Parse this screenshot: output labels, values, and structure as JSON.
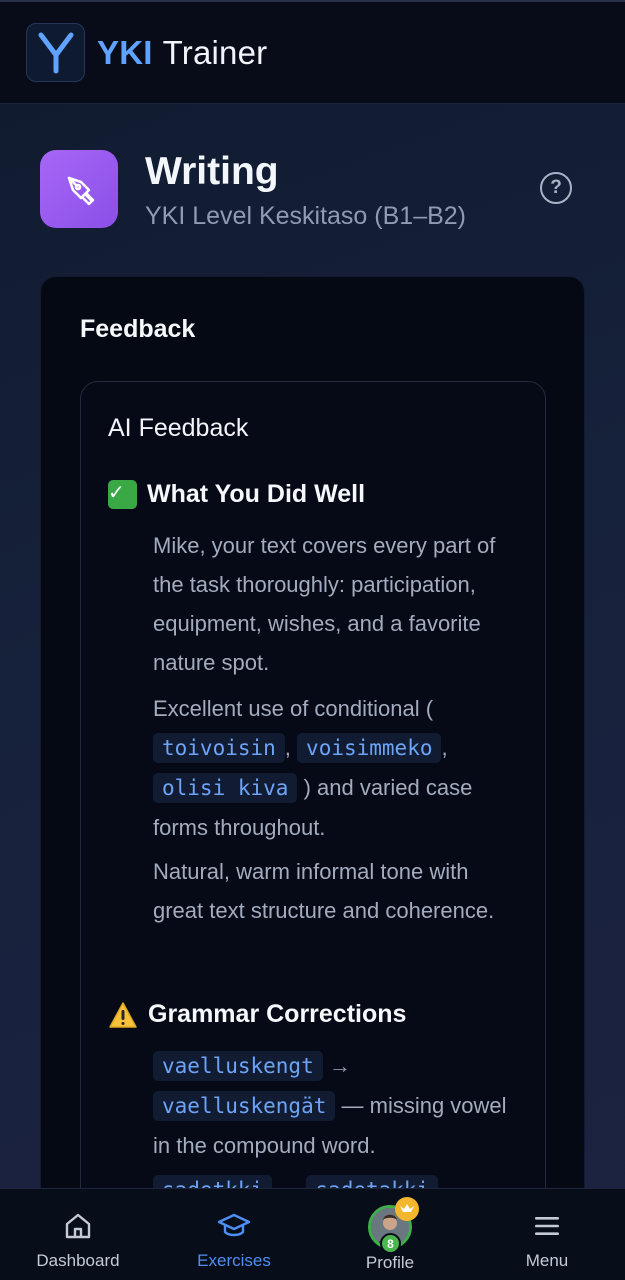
{
  "app": {
    "brand_part1": "YKI",
    "brand_part2": "Trainer",
    "logo_letter": "Y"
  },
  "header": {
    "title": "Writing",
    "subtitle": "YKI Level Keskitaso (B1–B2)",
    "help_icon": "question-circle-icon",
    "section_icon": "pen-icon",
    "accent": "#a066f5"
  },
  "feedback": {
    "card_title": "Feedback",
    "panel_title": "AI Feedback",
    "well": {
      "heading": "What You Did Well",
      "p1": "Mike, your text covers every part of the task thoroughly: participation, equipment, wishes, and a favorite nature spot.",
      "p2_pre": "Excellent use of conditional (",
      "p2_code1": "toivoisin",
      "p2_sep1": ",",
      "p2_code2": "voisimmeko",
      "p2_sep2": ",",
      "p2_code3": "olisi kiva",
      "p2_post": ") and varied case forms throughout.",
      "p3": "Natural, warm informal tone with great text structure and coherence."
    },
    "grammar": {
      "heading": "Grammar Corrections",
      "c1_wrong": "vaelluskengt",
      "arrow": "→",
      "c1_right": "vaelluskengät",
      "c1_note": "— missing vowel in the compound word.",
      "c2_wrong": "sadetkki",
      "c2_right": "sadetakki",
      "c2_note": "—"
    }
  },
  "nav": {
    "items": [
      {
        "label": "Dashboard",
        "icon": "home-icon"
      },
      {
        "label": "Exercises",
        "icon": "graduation-cap-icon"
      },
      {
        "label": "Profile",
        "icon": "avatar-icon",
        "level": "8"
      },
      {
        "label": "Menu",
        "icon": "hamburger-icon"
      }
    ],
    "active_color": "#4f8ef3"
  }
}
